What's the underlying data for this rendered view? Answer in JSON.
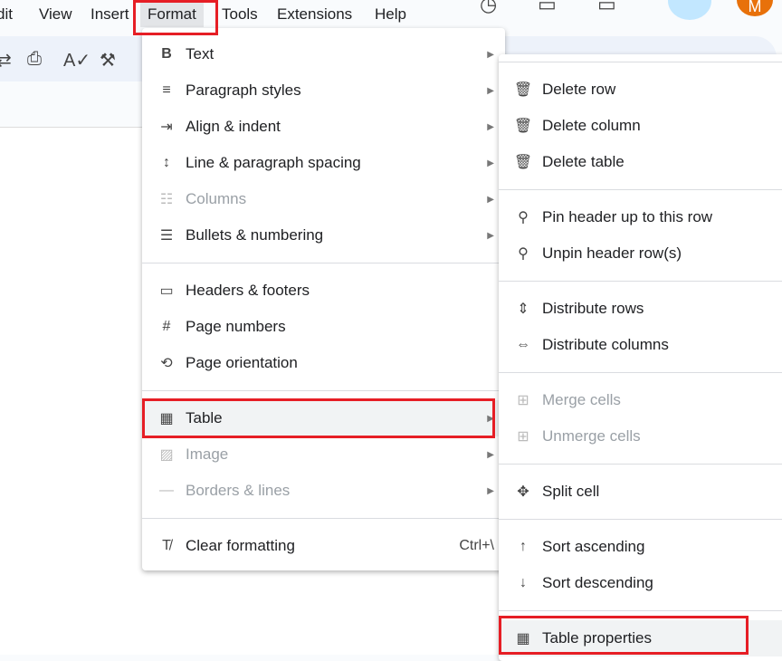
{
  "menubar": [
    "dit",
    "View",
    "Insert",
    "Format",
    "Tools",
    "Extensions",
    "Help"
  ],
  "avatar_letter": "M",
  "format_menu": [
    {
      "icon": "bold-icon",
      "glyph": "B",
      "label": "Text",
      "sub": true
    },
    {
      "icon": "paragraph-styles-icon",
      "glyph": "≡",
      "label": "Paragraph styles",
      "sub": true
    },
    {
      "icon": "align-indent-icon",
      "glyph": "⇥",
      "label": "Align & indent",
      "sub": true
    },
    {
      "icon": "line-spacing-icon",
      "glyph": "↕",
      "label": "Line & paragraph spacing",
      "sub": true
    },
    {
      "icon": "columns-icon",
      "glyph": "☷",
      "label": "Columns",
      "sub": true,
      "disabled": true
    },
    {
      "icon": "bullets-icon",
      "glyph": "☰",
      "label": "Bullets & numbering",
      "sub": true
    },
    {
      "icon": "headers-footers-icon",
      "glyph": "▭",
      "label": "Headers & footers"
    },
    {
      "icon": "page-numbers-icon",
      "glyph": "#",
      "label": "Page numbers"
    },
    {
      "icon": "page-orientation-icon",
      "glyph": "⟲",
      "label": "Page orientation"
    },
    {
      "icon": "table-icon",
      "glyph": "▦",
      "label": "Table",
      "sub": true,
      "active": true
    },
    {
      "icon": "image-icon",
      "glyph": "▨",
      "label": "Image",
      "sub": true,
      "disabled": true
    },
    {
      "icon": "borders-lines-icon",
      "glyph": "—",
      "label": "Borders & lines",
      "sub": true,
      "disabled": true
    },
    {
      "icon": "clear-formatting-icon",
      "glyph": "T̸",
      "label": "Clear formatting",
      "shortcut": "Ctrl+\\"
    }
  ],
  "table_menu": [
    {
      "icon": "trash-icon",
      "glyph": "🗑",
      "label": "Delete row"
    },
    {
      "icon": "trash-icon",
      "glyph": "🗑",
      "label": "Delete column"
    },
    {
      "icon": "trash-icon",
      "glyph": "🗑",
      "label": "Delete table"
    },
    {
      "icon": "pin-icon",
      "glyph": "⚲",
      "label": "Pin header up to this row"
    },
    {
      "icon": "unpin-icon",
      "glyph": "⚲",
      "label": "Unpin header row(s)"
    },
    {
      "icon": "distribute-rows-icon",
      "glyph": "⇕",
      "label": "Distribute rows"
    },
    {
      "icon": "distribute-columns-icon",
      "glyph": "⇔",
      "label": "Distribute columns"
    },
    {
      "icon": "merge-cells-icon",
      "glyph": "⊞",
      "label": "Merge cells",
      "disabled": true
    },
    {
      "icon": "unmerge-cells-icon",
      "glyph": "⊞",
      "label": "Unmerge cells",
      "disabled": true
    },
    {
      "icon": "split-cell-icon",
      "glyph": "✥",
      "label": "Split cell"
    },
    {
      "icon": "sort-ascending-icon",
      "glyph": "↑",
      "label": "Sort ascending"
    },
    {
      "icon": "sort-descending-icon",
      "glyph": "↓",
      "label": "Sort descending"
    },
    {
      "icon": "table-icon",
      "glyph": "▦",
      "label": "Table properties",
      "active": true
    }
  ],
  "colors": {
    "highlight": "#e61e25",
    "avatar": "#e8710a"
  }
}
